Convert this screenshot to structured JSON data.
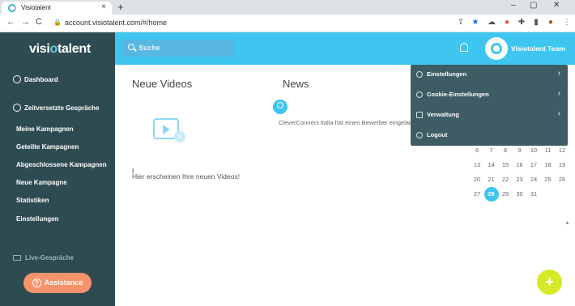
{
  "browser": {
    "tab_title": "Visiotalent",
    "tab_close": "×",
    "new_tab": "+",
    "url": "account.visiotalent.com/#/home",
    "nav_back": "←",
    "nav_forward": "→",
    "nav_reload": "C"
  },
  "logo": {
    "part1": "visi",
    "accent": "o",
    "part2": "talent"
  },
  "sidebar": {
    "dashboard": "Dashboard",
    "section": "Zeitversetzte Gespräche",
    "items": [
      "Meine Kampagnen",
      "Geteilte Kampagnen",
      "Abgeschlossene Kampagnen",
      "Neue Kampagne",
      "Statistiken",
      "Einstellungen"
    ],
    "live": "Live-Gespräche",
    "assist_icon": "?",
    "assist": "Assistance"
  },
  "topbar": {
    "search_placeholder": "Suche",
    "team": "Visiotalent Team"
  },
  "main": {
    "title": "Neue Videos",
    "empty_text": "Hier erscheinen Ihre neuen Videos!",
    "video_x": "×"
  },
  "news": {
    "title": "News",
    "text": "CleverConnect Italia hat einen Bewerber eingeladen"
  },
  "dropdown": {
    "items": [
      {
        "label": "Einstellungen",
        "icon": "gear-icon",
        "chevron": "›"
      },
      {
        "label": "Cookie-Einstellungen",
        "icon": "shield-icon",
        "chevron": "›"
      },
      {
        "label": "Verwaltung",
        "icon": "grid-icon",
        "chevron": "›"
      },
      {
        "label": "Logout",
        "icon": "power-icon",
        "chevron": ""
      }
    ]
  },
  "calendar": {
    "rows": [
      [
        "6",
        "7",
        "8",
        "9",
        "10",
        "11",
        "12"
      ],
      [
        "13",
        "14",
        "15",
        "16",
        "17",
        "18",
        "19"
      ],
      [
        "20",
        "21",
        "22",
        "23",
        "24",
        "25",
        "26"
      ],
      [
        "27",
        "28",
        "29",
        "30",
        "31",
        "",
        ""
      ]
    ],
    "today": "28"
  },
  "fab": "+",
  "colors": {
    "accent": "#3ec6f0",
    "sidebar": "#2f4b52",
    "assist": "#f7936b",
    "fab": "#d7ea27"
  }
}
